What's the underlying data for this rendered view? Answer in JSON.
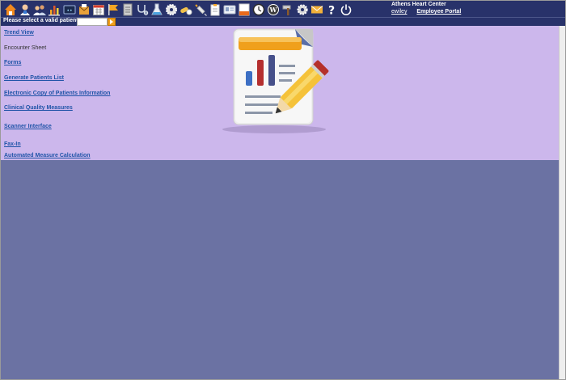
{
  "header": {
    "clinic_name": "Athens Heart Center",
    "user_link": "ewiley",
    "portal_link": "Employee Portal"
  },
  "toolbar": {
    "icons": [
      "home-icon",
      "calendar-person-icon",
      "patients-icon",
      "chart-icon",
      "messages-icon",
      "letters-icon",
      "schedule-icon",
      "flag-icon",
      "document-icon",
      "stethoscope-icon",
      "lab-icon",
      "settings-gear-icon",
      "pills-icon",
      "syringe-icon",
      "notes-icon",
      "id-card-icon",
      "report-icon",
      "clock-icon",
      "wordpress-icon",
      "hammer-icon",
      "cog-icon",
      "mail-icon",
      "help-icon",
      "power-icon"
    ]
  },
  "patient_bar": {
    "label": "Please select a valid patient.",
    "input_value": ""
  },
  "menu": {
    "items": [
      {
        "label": "Trend View",
        "link": true
      },
      {
        "label": "Encounter Sheet",
        "link": false
      },
      {
        "label": "Forms",
        "link": true
      },
      {
        "label": "Generate Patients List",
        "link": true
      },
      {
        "label": "Electronic Copy of Patients Information",
        "link": true
      },
      {
        "label": "Clinical Quality Measures",
        "link": true
      },
      {
        "label": "Scanner Interface",
        "link": true
      },
      {
        "label": "Fax-In",
        "link": true
      },
      {
        "label": "Automated Measure Calculation",
        "link": true
      }
    ]
  },
  "colors": {
    "toolbar_bg": "#28326a",
    "menu_bg": "#ccb7ec",
    "workspace_bg": "#6b72a3",
    "link": "#2054a8"
  }
}
